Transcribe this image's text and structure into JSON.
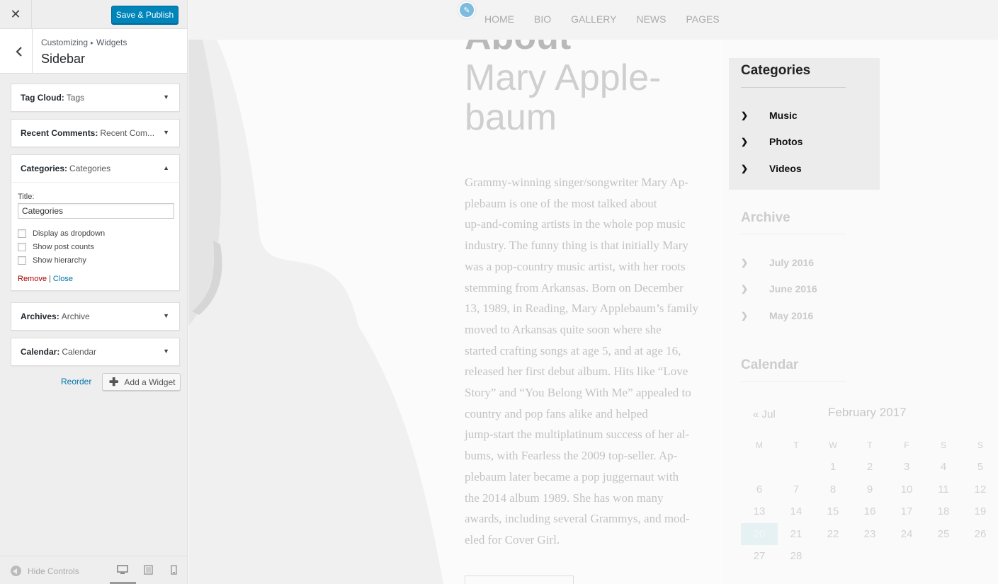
{
  "customizer": {
    "close_icon": "close-icon",
    "save_label": "Save & Publish",
    "breadcrumb_root": "Customizing",
    "breadcrumb_sep": "▸",
    "breadcrumb_section": "Widgets",
    "section_title": "Sidebar",
    "widgets": [
      {
        "type": "Tag Cloud:",
        "title": "Tags"
      },
      {
        "type": "Recent Comments:",
        "title": "Recent Com..."
      },
      {
        "type": "Categories:",
        "title": "Categories"
      },
      {
        "type": "Archives:",
        "title": "Archive"
      },
      {
        "type": "Calendar:",
        "title": "Calendar"
      }
    ],
    "expanded": {
      "title_label": "Title:",
      "title_value": "Categories",
      "checkboxes": [
        "Display as dropdown",
        "Show post counts",
        "Show hierarchy"
      ],
      "remove_label": "Remove",
      "pipe": "|",
      "close_label": "Close"
    },
    "reorder_label": "Reorder",
    "add_widget_label": "Add a Widget",
    "hide_controls_label": "Hide Controls",
    "accent": "#0085ba"
  },
  "preview": {
    "nav": [
      "HOME",
      "BIO",
      "GALLERY",
      "NEWS",
      "PAGES"
    ],
    "about_word": "About",
    "name_line1": "Mary Apple-",
    "name_line2": "baum",
    "body_lines": [
      "Grammy-winning singer/songwriter Mary Ap-",
      "plebaum is one of the most talked about",
      "up-and-coming artists in the whole pop music",
      "industry. The funny thing is that initially Mary",
      "was a pop-country music artist, with her roots",
      "stemming from Arkansas. Born on December",
      "13, 1989, in Reading, Mary Applebaum’s family",
      "moved to Arkansas quite soon where she",
      "started crafting songs at age 5, and at age 16,",
      "released her first debut album. Hits like “Love",
      "Story” and “You Belong With Me” appealed to",
      "country and pop fans alike and helped",
      "jump-start the multiplatinum success of her al-",
      "bums, with Fearless the 2009 top-seller. Ap-",
      "plebaum later became a pop juggernaut with",
      "the 2014 album 1989. She has won many",
      "awards, including several Grammys, and mod-",
      "eled for Cover Girl."
    ],
    "categories": {
      "title": "Categories",
      "items": [
        "Music",
        "Photos",
        "Videos"
      ]
    },
    "archive": {
      "title": "Archive",
      "items": [
        "July 2016",
        "June 2016",
        "May 2016"
      ]
    },
    "calendar": {
      "title": "Calendar",
      "prev": "« Jul",
      "month": "February 2017",
      "days_header": [
        "M",
        "T",
        "W",
        "T",
        "F",
        "S",
        "S"
      ],
      "days": [
        "1",
        "2",
        "3",
        "4",
        "5",
        "6",
        "7",
        "8",
        "9",
        "10",
        "11",
        "12",
        "13",
        "14",
        "15",
        "16",
        "17",
        "18",
        "19",
        "20",
        "21",
        "22",
        "23",
        "24",
        "25",
        "26",
        "27",
        "28"
      ],
      "today": "20"
    }
  }
}
